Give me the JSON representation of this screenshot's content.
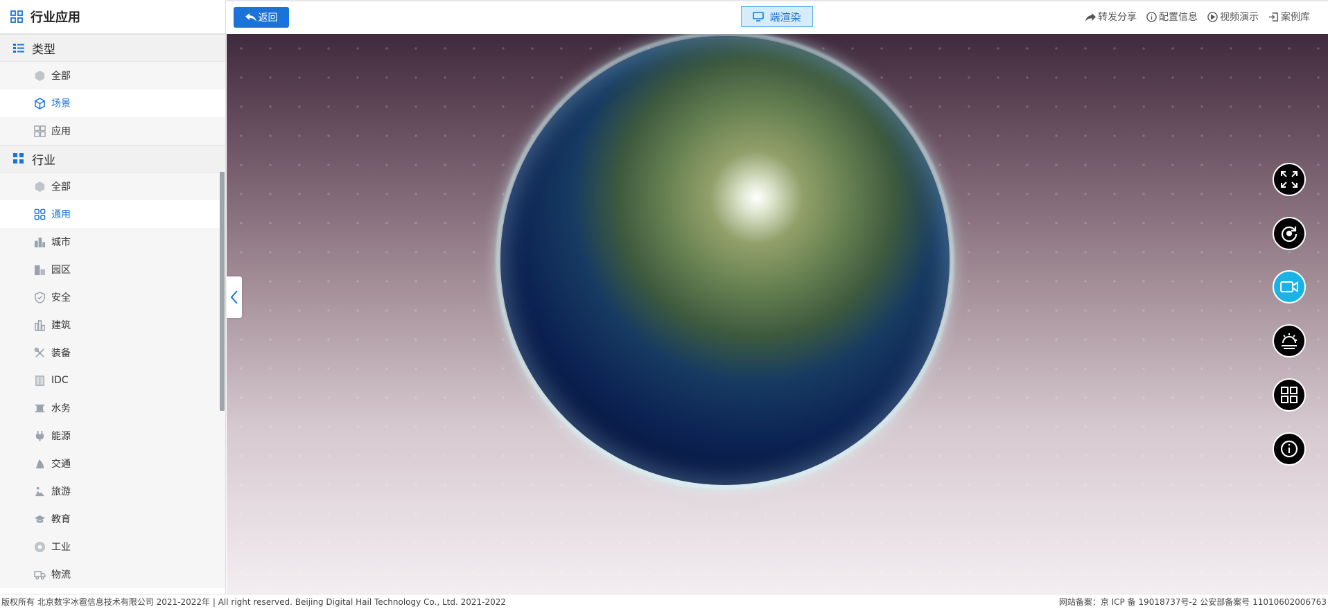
{
  "sidebar": {
    "title": "行业应用",
    "groups": [
      {
        "label": "类型",
        "items": [
          {
            "label": "全部",
            "icon": "cube-outline-icon",
            "active": false
          },
          {
            "label": "场景",
            "icon": "cube-icon",
            "active": true
          },
          {
            "label": "应用",
            "icon": "grid-apps-icon",
            "active": false
          }
        ]
      },
      {
        "label": "行业",
        "items": [
          {
            "label": "全部",
            "icon": "cube-outline-icon",
            "active": false
          },
          {
            "label": "通用",
            "icon": "four-squares-icon",
            "active": true
          },
          {
            "label": "城市",
            "icon": "city-icon",
            "active": false
          },
          {
            "label": "园区",
            "icon": "park-icon",
            "active": false
          },
          {
            "label": "安全",
            "icon": "shield-icon",
            "active": false
          },
          {
            "label": "建筑",
            "icon": "building-icon",
            "active": false
          },
          {
            "label": "装备",
            "icon": "tools-icon",
            "active": false
          },
          {
            "label": "IDC",
            "icon": "server-icon",
            "active": false
          },
          {
            "label": "水务",
            "icon": "water-icon",
            "active": false
          },
          {
            "label": "能源",
            "icon": "plug-icon",
            "active": false
          },
          {
            "label": "交通",
            "icon": "traffic-icon",
            "active": false
          },
          {
            "label": "旅游",
            "icon": "travel-icon",
            "active": false
          },
          {
            "label": "教育",
            "icon": "graduation-icon",
            "active": false
          },
          {
            "label": "工业",
            "icon": "industry-icon",
            "active": false
          },
          {
            "label": "物流",
            "icon": "truck-icon",
            "active": false
          }
        ]
      }
    ]
  },
  "topbar": {
    "back_label": "返回",
    "render_label": "端渲染",
    "links": [
      {
        "label": "转发分享",
        "icon": "share-icon"
      },
      {
        "label": "配置信息",
        "icon": "info-icon"
      },
      {
        "label": "视频演示",
        "icon": "play-icon"
      },
      {
        "label": "案例库",
        "icon": "enter-icon"
      }
    ]
  },
  "tools": [
    {
      "name": "fullscreen-icon",
      "active": false
    },
    {
      "name": "rotate-icon",
      "active": false
    },
    {
      "name": "video-camera-icon",
      "active": true
    },
    {
      "name": "weather-icon",
      "active": false
    },
    {
      "name": "layout-grid-icon",
      "active": false
    },
    {
      "name": "info-circle-icon",
      "active": false
    }
  ],
  "footer": {
    "left": "版权所有 北京数字冰雹信息技术有限公司 2021-2022年 | All right reserved. Beijing Digital Hail Technology Co., Ltd. 2021-2022",
    "right": "网站备案：京 ICP 备 19018737号-2 公安部备案号 11010602006763"
  },
  "colors": {
    "accent": "#1a73d9",
    "active_tool": "#1ab3e6"
  }
}
